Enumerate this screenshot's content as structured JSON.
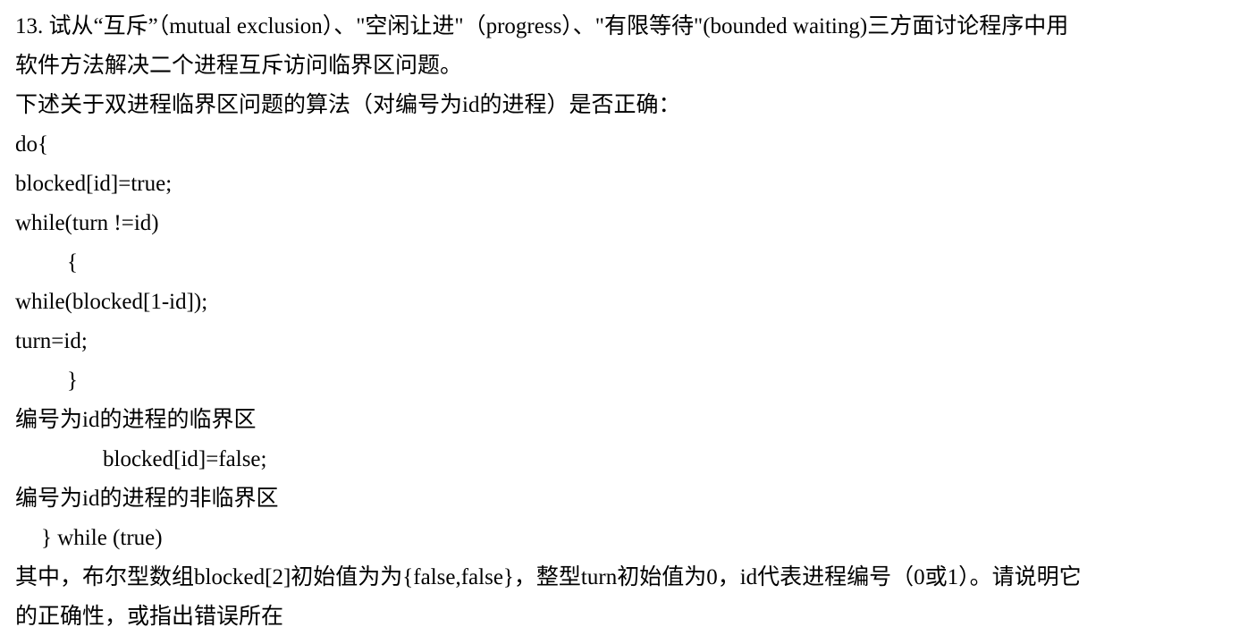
{
  "question": {
    "lines": [
      "13. 试从“互斥”（mutual exclusion）、\"空闲让进\"（progress）、\"有限等待\"(bounded waiting)三方面讨论程序中用",
      "软件方法解决二个进程互斥访问临界区问题。",
      "下述关于双进程临界区问题的算法（对编号为id的进程）是否正确：",
      "do{",
      "blocked[id]=true;",
      "while(turn !=id)",
      "{",
      "while(blocked[1-id]);",
      "turn=id;",
      "}",
      "编号为id的进程的临界区",
      "blocked[id]=false;",
      "编号为id的进程的非临界区",
      "} while (true)",
      "其中，布尔型数组blocked[2]初始值为为{false,false}，整型turn初始值为0，id代表进程编号（0或1）。请说明它",
      "的正确性，或指出错误所在"
    ]
  }
}
